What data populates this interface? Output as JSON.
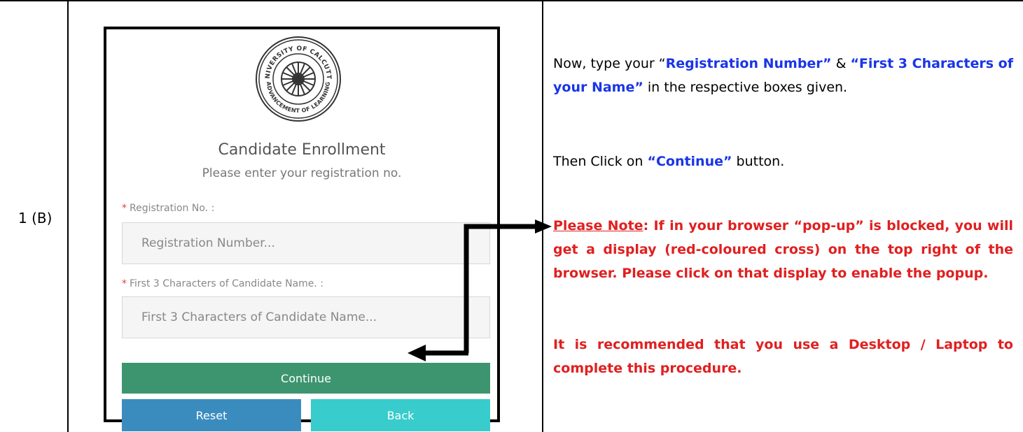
{
  "row": {
    "label": "1 (B)"
  },
  "form": {
    "title": "Candidate Enrollment",
    "subtitle": "Please enter your registration no.",
    "required_mark": "*",
    "registration_label": "Registration No. :",
    "registration_placeholder": "Registration Number...",
    "name_label": "First 3 Characters of Candidate Name. :",
    "name_placeholder": "First 3 Characters of Candidate Name...",
    "continue_label": "Continue",
    "reset_label": "Reset",
    "back_label": "Back",
    "logo_text_top": "UNIVERSITY OF CALCUTTA",
    "logo_text_bottom": "ADVANCEMENT OF LEARNING"
  },
  "instructions": {
    "p1_before": "Now, type your “",
    "p1_reg": "Registration Number”",
    "p1_and": " & ",
    "p1_name": "“First 3 Characters of your Name”",
    "p1_after": " in the respective boxes given.",
    "p2_before": "Then Click on ",
    "p2_continue": "“Continue”",
    "p2_after": " button.",
    "note_heading": "Please Note",
    "note_colon": ":",
    "note_text": " If in your browser “pop-up” is blocked, you will get a display (red-coloured cross) on the top right of the browser. Please click on that display to enable the popup.",
    "recommend_text": "It is recommended that you use a Desktop / Laptop to complete this procedure."
  },
  "colors": {
    "continue_button": "#3d9570",
    "reset_button": "#3a8cbf",
    "back_button": "#38cccc",
    "highlight_blue": "#1a35e6",
    "highlight_red": "#e02020"
  }
}
